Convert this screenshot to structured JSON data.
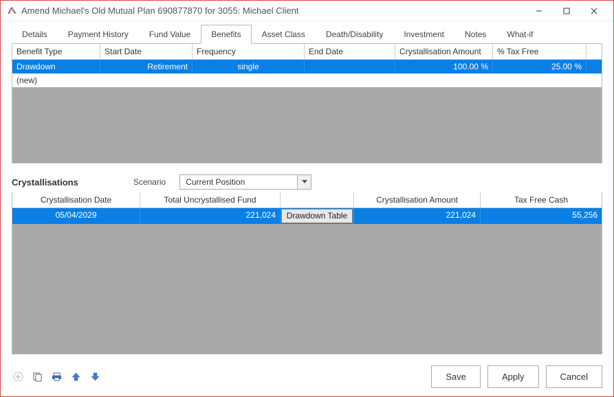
{
  "window": {
    "title": "Amend Michael's Old Mutual Plan 690877870 for 3055: Michael Client"
  },
  "tabs": [
    "Details",
    "Payment History",
    "Fund Value",
    "Benefits",
    "Asset Class",
    "Death/Disability",
    "Investment",
    "Notes",
    "What-if"
  ],
  "active_tab_index": 3,
  "benefits": {
    "headers": [
      "Benefit Type",
      "Start Date",
      "Frequency",
      "End Date",
      "Crystallisation Amount",
      "% Tax Free"
    ],
    "rows": [
      {
        "type": "Drawdown",
        "start": "Retirement",
        "freq": "single",
        "end": "",
        "amount": "100.00 %",
        "taxfree": "25.00 %",
        "selected": true
      },
      {
        "type": "(new)",
        "start": "",
        "freq": "",
        "end": "",
        "amount": "",
        "taxfree": "",
        "selected": false,
        "is_new": true
      }
    ]
  },
  "crystallisations": {
    "title": "Crystallisations",
    "scenario_label": "Scenario",
    "scenario_value": "Current Position",
    "headers": [
      "Crystallisation Date",
      "Total Uncrystallised Fund",
      "",
      "Crystallisation Amount",
      "Tax Free Cash"
    ],
    "drawdown_button": "Drawdown Table",
    "rows": [
      {
        "date": "05/04/2029",
        "fund": "221,024",
        "amount": "221,024",
        "cash": "55,256",
        "selected": true
      }
    ]
  },
  "footer": {
    "save": "Save",
    "apply": "Apply",
    "cancel": "Cancel"
  }
}
